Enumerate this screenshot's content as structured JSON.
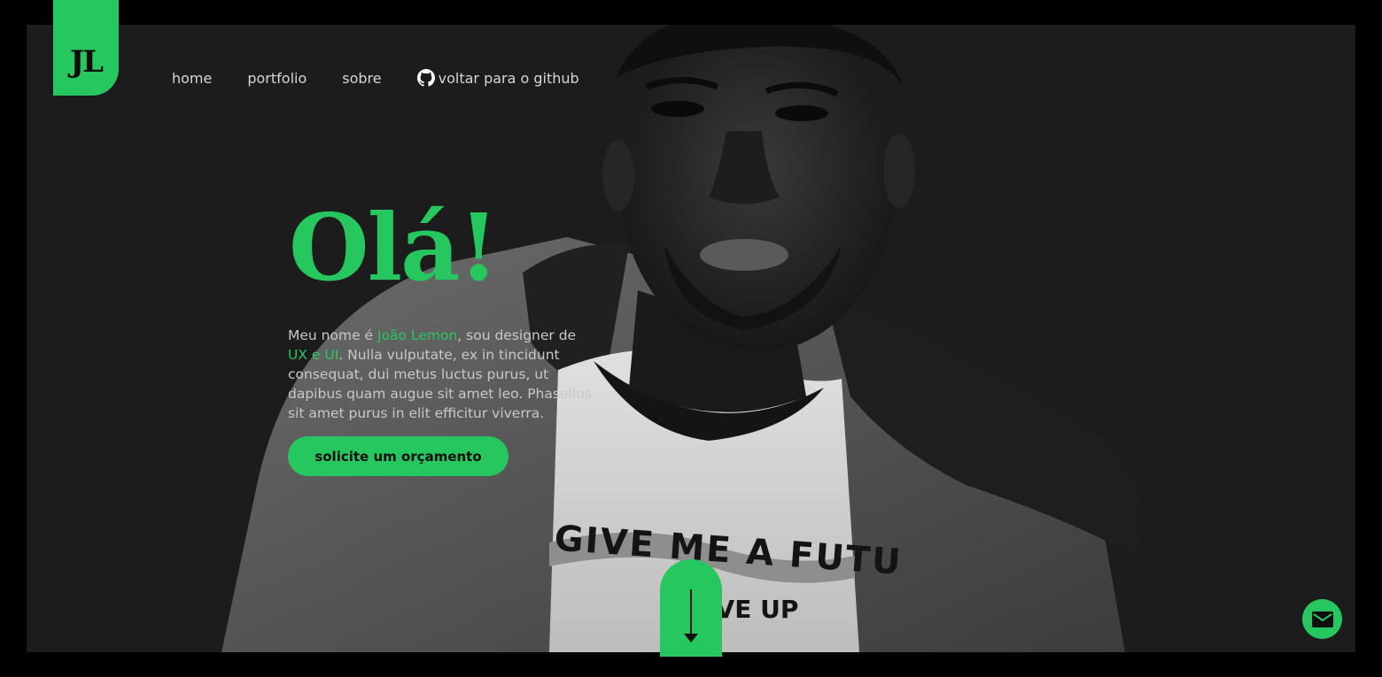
{
  "logo": {
    "text": "JL"
  },
  "nav": {
    "items": [
      {
        "label": "home"
      },
      {
        "label": "portfolio"
      },
      {
        "label": "sobre"
      }
    ],
    "github": {
      "label": "voltar para o github",
      "icon": "github-icon"
    }
  },
  "hero": {
    "title": "Olá!",
    "intro": {
      "part1": "Meu nome é ",
      "name": "João Lemon",
      "part2": ", sou designer de ",
      "role": "UX e UI",
      "part3": ". Nulla vulputate, ex in tincidunt consequat, dui metus luctus purus, ut dapibus quam augue sit amet leo. Phasellus sit amet purus in elit efficitur viverra."
    },
    "cta_label": "solicite um orçamento"
  },
  "photo": {
    "shirt_line1": "GIVE ME A FUTU",
    "shirt_line2": "NEVE UP"
  },
  "icons": {
    "scroll": "arrow-down-icon",
    "mail": "mail-icon"
  },
  "colors": {
    "accent": "#27c75f",
    "background": "#1c1c1c",
    "text": "#c8c8c8"
  }
}
